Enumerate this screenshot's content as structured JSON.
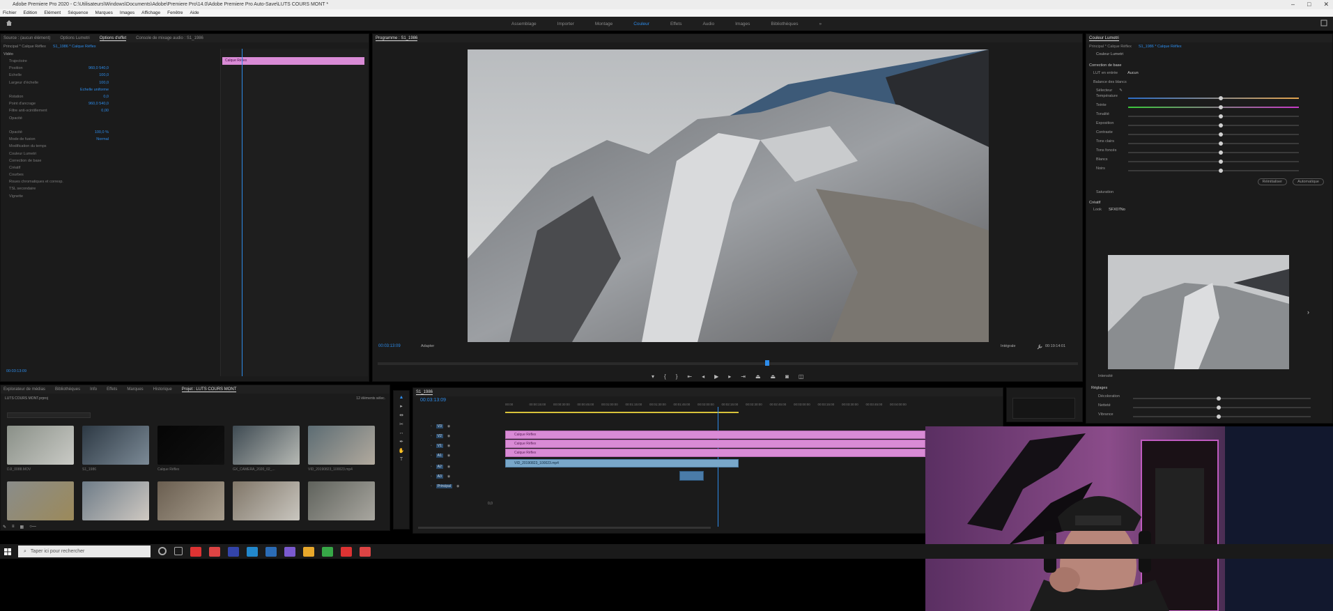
{
  "window": {
    "title": "Adobe Premiere Pro 2020 - C:\\Utilisateurs\\Windows\\Documents\\Adobe\\Premiere Pro\\14.0\\Adobe Premiere Pro Auto-Save\\LUTS COURS MONT *",
    "min_icon": "minimize-icon",
    "max_icon": "maximize-icon",
    "close_icon": "close-icon"
  },
  "menu": [
    "Fichier",
    "Edition",
    "Elément",
    "Séquence",
    "Marques",
    "Images",
    "Affichage",
    "Fenêtre",
    "Aide"
  ],
  "workspaces": {
    "items": [
      "Assemblage",
      "Importer",
      "Montage",
      "Couleur",
      "Effets",
      "Audio",
      "Images",
      "Bibliothèques"
    ],
    "active": "Couleur",
    "more": "»"
  },
  "effect_controls": {
    "tabs": [
      "Source : (aucun élément)",
      "Options Lumetri",
      "Options d'effet",
      "Console de mixage audio : S1_1986"
    ],
    "active_tab": "Options d'effet",
    "master": "Principal * Calque Réflex",
    "seq": "S1_1986 * Calque Réflex",
    "section": "Vidéo",
    "rows": [
      {
        "label": "Trajectoire",
        "value": ""
      },
      {
        "label": "Position",
        "value": "960,0   540,0"
      },
      {
        "label": "Echelle",
        "value": "100,0"
      },
      {
        "label": "Largeur d'échelle",
        "value": "100,0"
      },
      {
        "label": "",
        "value": "Echelle uniforme"
      },
      {
        "label": "Rotation",
        "value": "0,0"
      },
      {
        "label": "Point d'ancrage",
        "value": "960,0   540,0"
      },
      {
        "label": "Filtre anti-scintillement",
        "value": "0,00"
      },
      {
        "label": "Opacité",
        "value": ""
      },
      {
        "label": "",
        "value": ""
      },
      {
        "label": "Opacité",
        "value": "100,0 %"
      },
      {
        "label": "Mode de fusion",
        "value": "Normal"
      },
      {
        "label": "Modification du temps",
        "value": ""
      },
      {
        "label": "Couleur Lumetri",
        "value": ""
      },
      {
        "label": "Correction de base",
        "value": ""
      },
      {
        "label": "Créatif",
        "value": ""
      },
      {
        "label": "Courbes",
        "value": ""
      },
      {
        "label": "Roues chromatiques et corresp.",
        "value": ""
      },
      {
        "label": "TSL secondaire",
        "value": ""
      },
      {
        "label": "Vignette",
        "value": ""
      }
    ],
    "mini_clip": "Calque Réflex",
    "timecode": "00:03:13:09"
  },
  "program": {
    "tab": "Programme : S1_1986",
    "timecode": "00:03:13:09",
    "fit": "Adapter",
    "quality": "Intégrale",
    "duration": "00:19:14:01"
  },
  "lumetri": {
    "tab": "Couleur Lumetri",
    "master": "Principal * Calque Réflex",
    "seq": "S1_1986 * Calque Réflex",
    "fx": "Couleur Lumetri",
    "section_basic": "Correction de base",
    "lut_label": "LUT en entrée",
    "lut_value": "Aucun",
    "wb_label": "Balance des blancs",
    "wb_selector": "Sélecteur",
    "sliders": [
      "Température",
      "Teinte",
      "Tonalité",
      "Exposition",
      "Contraste",
      "Tons clairs",
      "Tons foncés",
      "Blancs",
      "Noirs"
    ],
    "btn_reset": "Réinitialiser",
    "btn_auto": "Automatique",
    "saturation": "Saturation",
    "creative": "Créatif",
    "look_label": "Look",
    "look_value": "SFX07No",
    "intensity": "Intensité",
    "adjust": "Réglages",
    "adjust_rows": [
      "Décoloration",
      "Netteté",
      "Vibrance"
    ]
  },
  "project": {
    "tabs": [
      "Explorateur de médias",
      "Bibliothèques",
      "Info",
      "Effets",
      "Marques",
      "Historique",
      "Projet : LUTS COURS MONT"
    ],
    "active_tab": "Projet : LUTS COURS MONT",
    "path": "LUTS COURS MONT.prproj",
    "count": "12 éléments sélec.",
    "items": [
      {
        "label": "DJI_0088.MOV",
        "colors": [
          "#8a9088",
          "#c9cac5"
        ]
      },
      {
        "label": "S1_1986",
        "colors": [
          "#2d3944",
          "#7c8a96"
        ]
      },
      {
        "label": "Calque Réflex",
        "colors": [
          "#050505",
          "#101010"
        ]
      },
      {
        "label": "GX_CAMERA_2020_02_...",
        "colors": [
          "#3e4a52",
          "#b6b9b4"
        ]
      },
      {
        "label": "VID_20190823_100023.mp4",
        "colors": [
          "#5c6c73",
          "#b2aa9e"
        ]
      },
      {
        "label": "",
        "colors": [
          "#8a8c8a",
          "#9c8a5a"
        ]
      },
      {
        "label": "",
        "colors": [
          "#6e7c88",
          "#cfc9c2"
        ]
      },
      {
        "label": "",
        "colors": [
          "#6a5e50",
          "#a89e8e"
        ]
      },
      {
        "label": "",
        "colors": [
          "#807668",
          "#c9c6bf"
        ]
      },
      {
        "label": "",
        "colors": [
          "#5f625c",
          "#a9a7a0"
        ]
      }
    ]
  },
  "timeline": {
    "tab": "S1_1986",
    "timecode": "00:03:13:09",
    "ruler": [
      "00:00",
      "00:00:15:00",
      "00:00:30:00",
      "00:00:45:00",
      "00:01:00:00",
      "00:01:15:00",
      "00:01:30:00",
      "00:01:45:00",
      "00:02:00:00",
      "00:02:15:00",
      "00:02:30:00",
      "00:02:45:00",
      "00:03:00:00",
      "00:03:15:00",
      "00:03:30:00",
      "00:03:45:00",
      "00:04:00:00"
    ],
    "clips": [
      "Calque Réflex",
      "Calque Réflex",
      "Calque Réflex",
      "VID_20190823_100023.mp4"
    ],
    "tracks": [
      "V3",
      "V2",
      "V1",
      "A1",
      "A2",
      "A3",
      "Principal"
    ],
    "principal": "Principal",
    "principal_value": "0,0"
  },
  "taskbar": {
    "search_placeholder": "Taper ici pour rechercher",
    "icons": [
      "#e8a82b",
      "#37a847",
      "#d33",
      "#d44",
      "#34a",
      "#28c",
      "#2b6cb6",
      "#7b5ad0"
    ]
  }
}
